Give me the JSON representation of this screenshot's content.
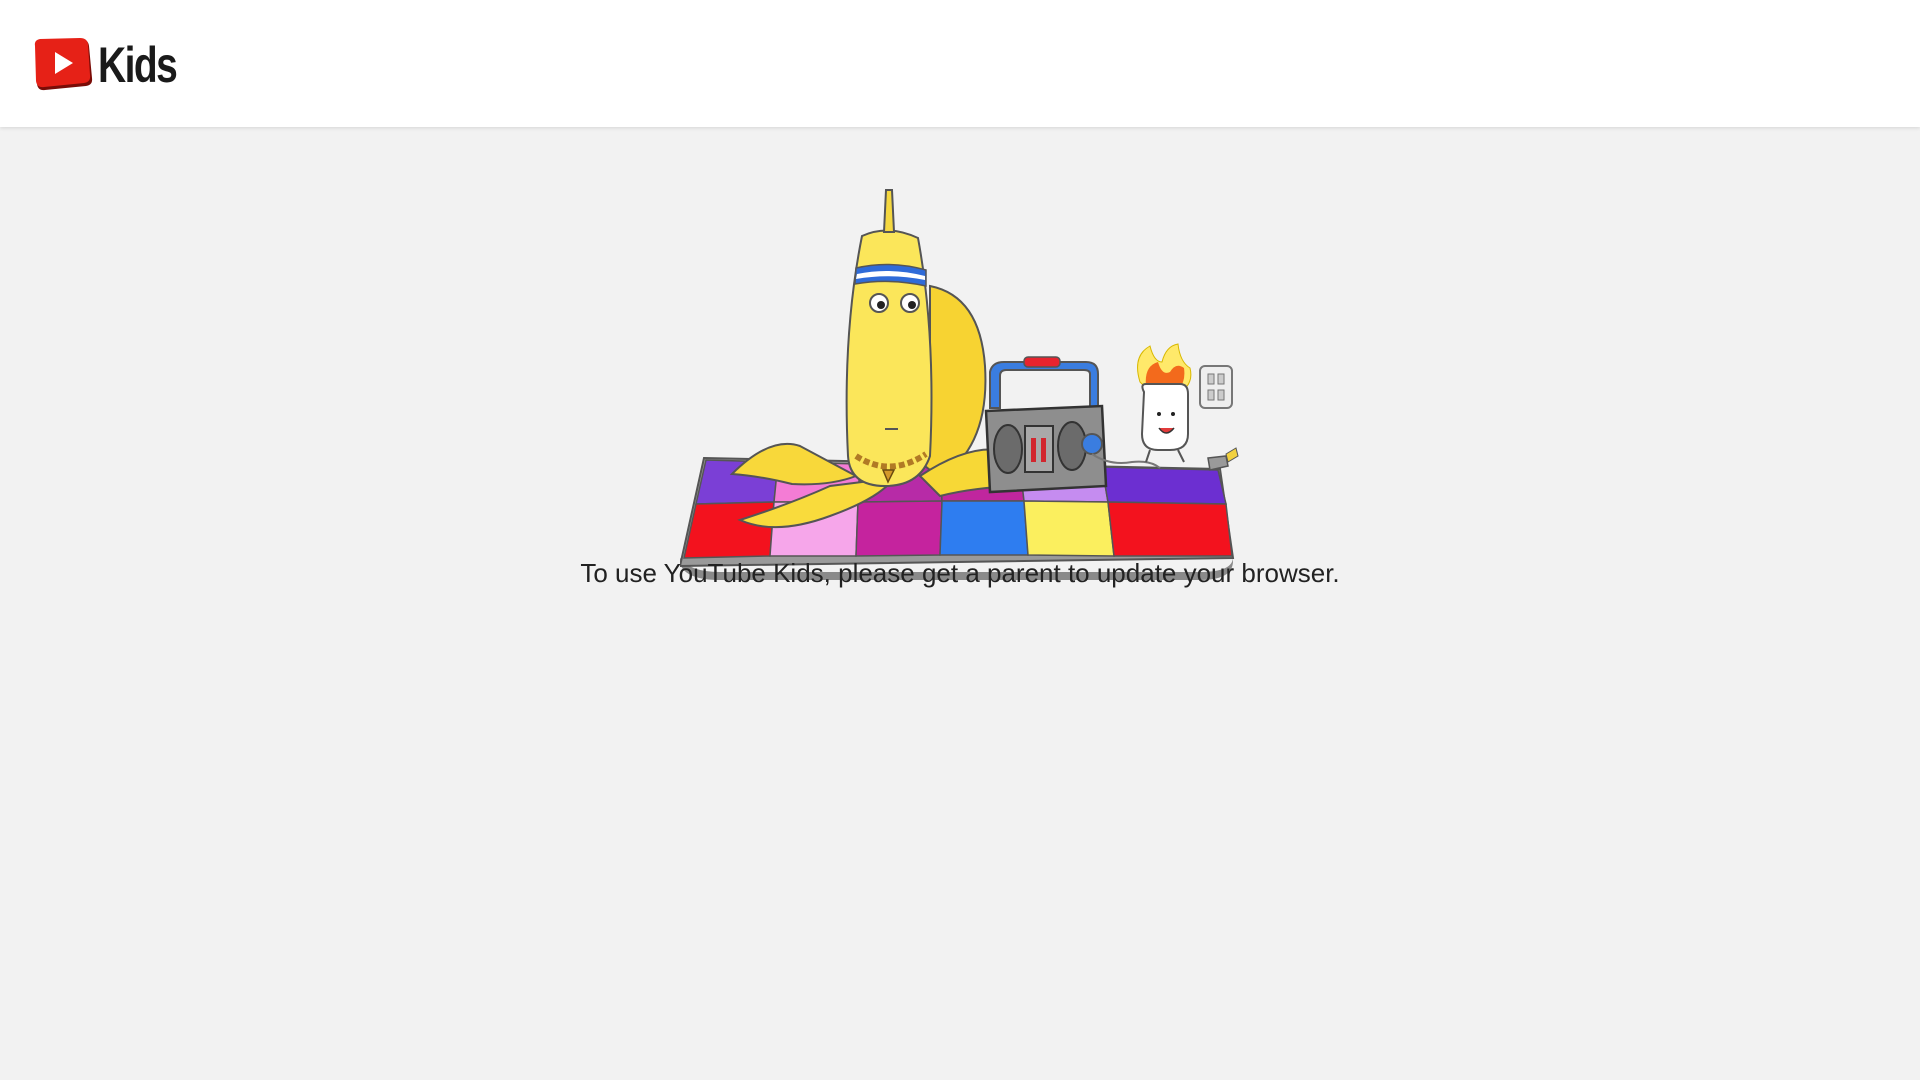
{
  "header": {
    "logo": {
      "icon": "youtube-play-icon",
      "text": "Kids",
      "brand_color": "#e62117"
    }
  },
  "main": {
    "illustration": "banana-boombox-dance-floor-illustration",
    "message": "To use YouTube Kids, please get a parent to update your browser."
  },
  "colors": {
    "background": "#f2f2f2",
    "header_background": "#ffffff",
    "text": "#222222"
  }
}
